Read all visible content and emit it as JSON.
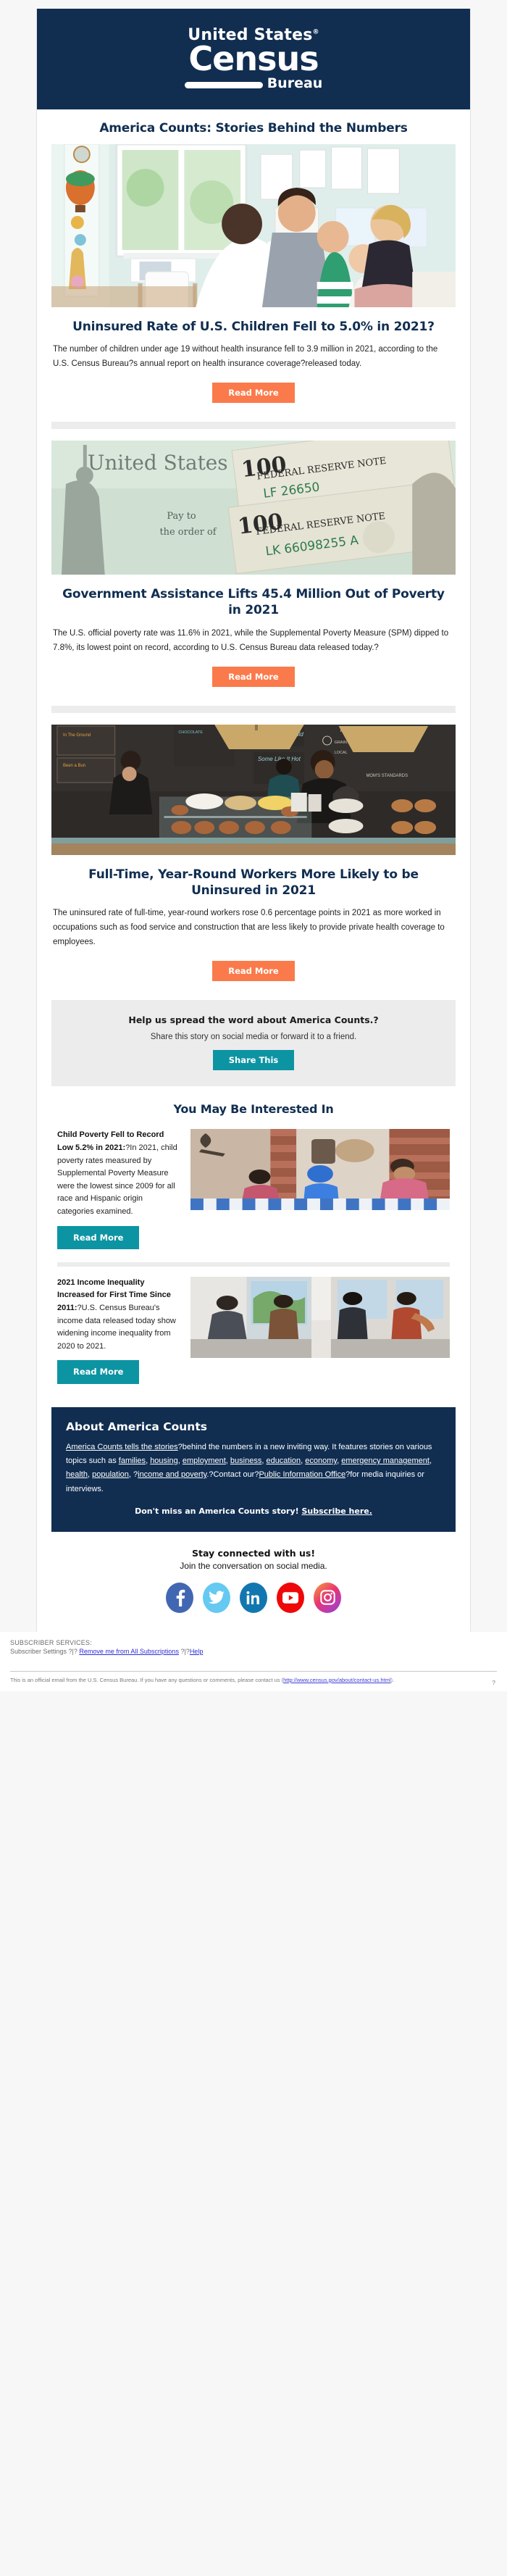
{
  "masthead": {
    "logo_line1": "United States",
    "logo_reg": "®",
    "logo_line2": "Census",
    "logo_line3": "Bureau"
  },
  "brand_title": "America Counts: Stories Behind the Numbers",
  "articles": [
    {
      "image_name": "doctor-examining-child-photo",
      "title": "Uninsured Rate of U.S. Children Fell to 5.0% in 2021?",
      "body": "The number of children under age 19 without health insurance fell to 3.9 million in 2021, according to the U.S. Census Bureau?s annual report on health insurance coverage?released today.",
      "button": "Read More"
    },
    {
      "image_name": "treasury-check-and-hundred-dollar-bills-photo",
      "title": "Government Assistance Lifts 45.4 Million Out of Poverty in 2021",
      "body": "The U.S. official poverty rate was 11.6% in 2021, while the Supplemental Poverty Measure (SPM) dipped to 7.8%, its lowest point on record, according to U.S. Census Bureau data released today.?",
      "button": "Read More"
    },
    {
      "image_name": "cafe-bakery-workers-photo",
      "title": "Full-Time, Year-Round Workers More Likely to be Uninsured in 2021",
      "body": "The uninsured rate of full-time, year-round workers rose 0.6 percentage points in 2021 as more worked in occupations such as food service and construction that are less likely to provide private health coverage to employees.",
      "button": "Read More"
    }
  ],
  "share": {
    "title": "Help us spread the word about America Counts.?",
    "subtitle": "Share this story on social media or forward it to a friend.",
    "button": "Share This"
  },
  "interested": {
    "heading": "You May Be Interested In",
    "items": [
      {
        "lead": "Child Poverty Fell to Record Low 5.2% in 2021:",
        "body": "?In 2021, child poverty rates measured by Supplemental Poverty Measure were the lowest since 2009 for all race and Hispanic origin categories examined.",
        "button": "Read More",
        "image_name": "family-at-kitchen-table-photo"
      },
      {
        "lead": "2021 Income Inequality Increased for First Time Since 2011:",
        "body": "?U.S. Census Bureau's income data released today show widening income inequality from 2020 to 2021.",
        "button": "Read More",
        "image_name": "people-on-city-street-photo"
      }
    ]
  },
  "about": {
    "heading": "About America Counts",
    "link_lead": "America Counts tells the stories",
    "text_1": "?behind the numbers in a new inviting way. It features stories on various topics such as ",
    "links": [
      "families",
      "housing",
      "employment",
      "business",
      "education",
      "economy",
      "emergency management",
      "health",
      "population",
      "income and poverty"
    ],
    "text_2": ".?Contact our?",
    "link_pio": "Public Information Office",
    "text_3": "?for media inquiries or interviews.",
    "subscribe_text": "Don't miss an America Counts story! ",
    "subscribe_link": "Subscribe here."
  },
  "social": {
    "title": "Stay connected with us!",
    "subtitle": "Join the conversation on social media.",
    "icons": [
      "facebook-icon",
      "twitter-icon",
      "linkedin-icon",
      "youtube-icon",
      "instagram-icon"
    ]
  },
  "footer": {
    "subscriber_services_label": "SUBSCRIBER SERVICES:",
    "settings": "Subscriber Settings ?|? ",
    "unsubscribe": "Remove me from All Subscriptions",
    "settings_tail": " ?|?",
    "help": "Help",
    "legal_text": "This is an official email from the U.S. Census Bureau. If you have any questions or comments, please contact us (",
    "legal_link": "http://www.census.gov/about/contact-us.html",
    "legal_tail": ").",
    "right_mark": "?"
  },
  "colors": {
    "navy": "#112e51",
    "orange": "#fb7a4b",
    "teal": "#0d94a3",
    "band_gray": "#ececec"
  }
}
